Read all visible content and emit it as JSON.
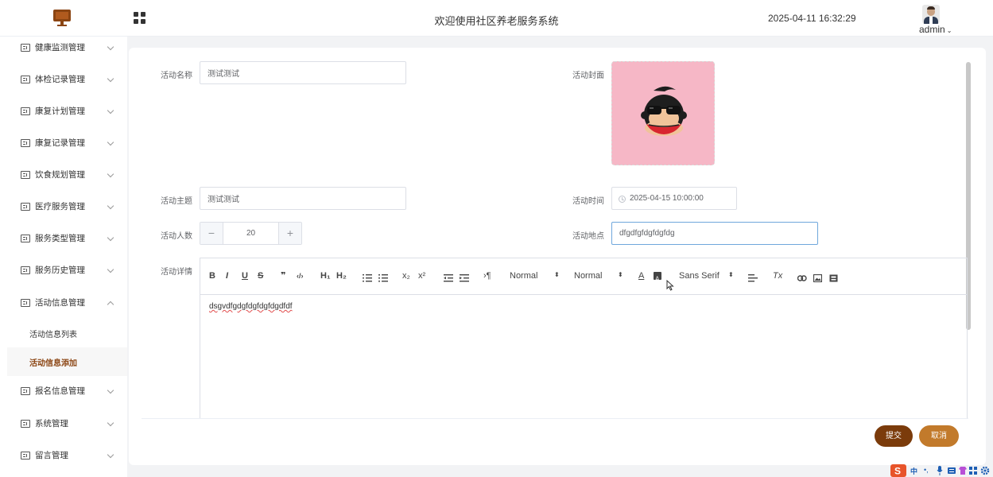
{
  "header": {
    "system_title": "欢迎使用社区养老服务系统",
    "datetime": "2025-04-11 16:32:29",
    "username": "admin",
    "caret": "⌄"
  },
  "sidebar": {
    "items": [
      {
        "label": "健康监测管理"
      },
      {
        "label": "体检记录管理"
      },
      {
        "label": "康复计划管理"
      },
      {
        "label": "康复记录管理"
      },
      {
        "label": "饮食规划管理"
      },
      {
        "label": "医疗服务管理"
      },
      {
        "label": "服务类型管理"
      },
      {
        "label": "服务历史管理"
      },
      {
        "label": "活动信息管理"
      },
      {
        "label": "报名信息管理"
      },
      {
        "label": "系统管理"
      },
      {
        "label": "留言管理"
      }
    ],
    "sub_items": [
      {
        "label": "活动信息列表"
      },
      {
        "label": "活动信息添加"
      }
    ]
  },
  "form": {
    "name_label": "活动名称",
    "name_value": "测试测试",
    "cover_label": "活动封面",
    "theme_label": "活动主题",
    "theme_value": "测试测试",
    "time_label": "活动时间",
    "time_value": "2025-04-15 10:00:00",
    "count_label": "活动人数",
    "count_value": "20",
    "minus": "−",
    "plus": "+",
    "place_label": "活动地点",
    "place_value": "dfgdfgfdgfdgfdg",
    "detail_label": "活动详情"
  },
  "editor": {
    "font_size_select": "Normal",
    "header_select": "Normal",
    "font_family_select": "Sans Serif",
    "content": "dsgvdfgdgfdgfdgfdgdfdf",
    "buttons": {
      "bold": "B",
      "italic": "I",
      "underline": "U",
      "strike": "S",
      "quote": "❞",
      "code": "‹/›",
      "h1": "H₁",
      "h2": "H₂",
      "subscript": "x₂",
      "superscript": "x²",
      "rtl": "›¶",
      "color": "A",
      "clean": "Tx"
    }
  },
  "actions": {
    "submit": "提交",
    "cancel": "取消"
  },
  "tray": {
    "ime": "中",
    "punct": "•,"
  },
  "colors": {
    "primary": "#7b3b0b",
    "secondary": "#c27a2b",
    "active_sub": "#8b4513",
    "cover_bg": "#f6b7c6"
  }
}
